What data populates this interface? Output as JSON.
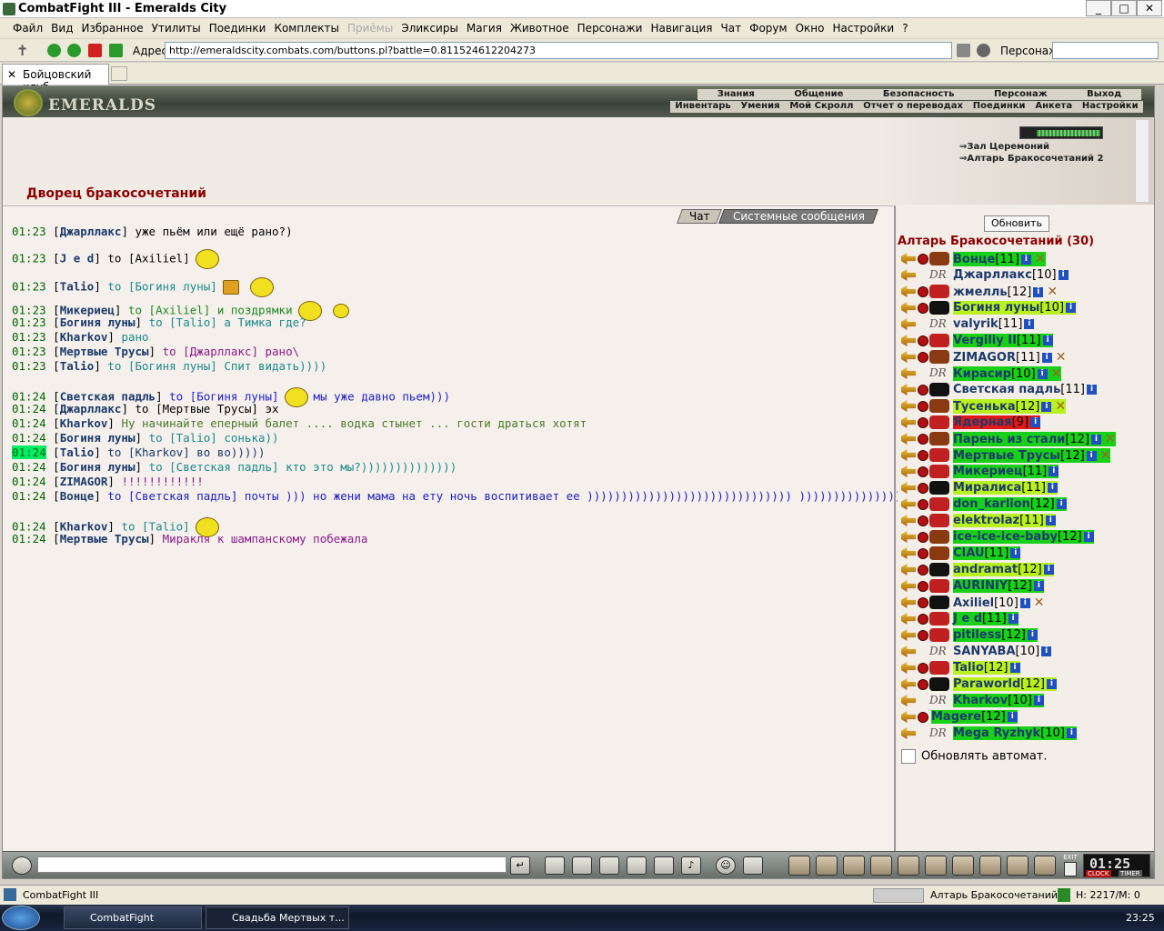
{
  "window": {
    "title": "CombatFight III - Emeralds City"
  },
  "menu": [
    "Файл",
    "Вид",
    "Избранное",
    "Утилиты",
    "Поединки",
    "Комплекты",
    "Приёмы",
    "Эликсиры",
    "Магия",
    "Животное",
    "Персонажи",
    "Навигация",
    "Чат",
    "Форум",
    "Окно",
    "Настройки",
    "?"
  ],
  "address": {
    "label": "Адрес:",
    "url": "http://emeraldscity.combats.com/buttons.pl?battle=0.811524612204273",
    "pers_label": "Персонаж:"
  },
  "tab": {
    "label": "Бойцовский клуб"
  },
  "logo": "EMERALDS",
  "nav1": [
    "Знания",
    "Общение",
    "Безопасность",
    "Персонаж",
    "Выход"
  ],
  "nav2": [
    "Инвентарь",
    "Умения",
    "Мой Скролл",
    "Отчет о переводах",
    "Поединки",
    "Анкета",
    "Настройки"
  ],
  "location": {
    "title": "Дворец бракосочетаний",
    "links": [
      "Зал Церемоний",
      "Алтарь Бракосочетаний 2"
    ]
  },
  "chat_tabs": {
    "chat": "Чат",
    "system": "Системные сообщения"
  },
  "messages": [
    {
      "time": "01:23",
      "nick": "Джарллакс",
      "text": "уже пьём или ещё рано?)",
      "color": "c-black"
    },
    {
      "time": "01:23",
      "nick": "J e d",
      "text": "to [Axiliel]",
      "color": "c-black"
    },
    {
      "time": "01:23",
      "nick": "Talio",
      "text": "to [Богиня луны]",
      "color": "c-teal"
    },
    {
      "time": "01:23",
      "nick": "Микериец",
      "text": "to [Axiliel] и поздрямки",
      "color": "c-green"
    },
    {
      "time": "01:23",
      "nick": "Богиня луны",
      "text": "to [Talio] а Тимка где?",
      "color": "c-teal"
    },
    {
      "time": "01:23",
      "nick": "Kharkov",
      "text": "рано",
      "color": "c-teal"
    },
    {
      "time": "01:23",
      "nick": "Мертвые Трусы",
      "text": "to [Джарллакс] рано\\",
      "color": "c-purple"
    },
    {
      "time": "01:23",
      "nick": "Talio",
      "text": "to [Богиня луны] Спит видать))))",
      "color": "c-teal"
    },
    {
      "time": "01:24",
      "nick": "Светская падль",
      "text": "to [Богиня луны]",
      "color": "c-blue"
    },
    {
      "time": "01:24",
      "nick": "Джарллакс",
      "text": "to [Мертвые Трусы] эх",
      "color": "c-black"
    },
    {
      "time": "01:24",
      "nick": "Kharkov",
      "text": "Ну начинайте еперный балет .... водка стынет ... гости драться хотят",
      "color": "c-olive"
    },
    {
      "time": "01:24",
      "nick": "Богиня луны",
      "text": "to [Talio] сонька))",
      "color": "c-teal"
    },
    {
      "time": "01:24",
      "nick": "Talio",
      "text": "to [Kharkov] во во)))))",
      "color": "c-navy"
    },
    {
      "time": "01:24",
      "nick": "Богиня луны",
      "text": "to [Светская падль] кто это мы?))))))))))))))",
      "color": "c-teal"
    },
    {
      "time": "01:24",
      "nick": "ZIMAGOR",
      "text": "!!!!!!!!!!!!",
      "color": "c-purple"
    },
    {
      "time": "01:24",
      "nick": "Вонце",
      "text": "to [Светская падль] почты ))) но жени мама на ету ночь воспитивает ее )))))))))))))))))))))))))))))) )))))))))))))))))))))))))",
      "color": "c-blue"
    },
    {
      "time": "01:24",
      "nick": "Kharkov",
      "text": "to [Talio]",
      "color": "c-teal"
    },
    {
      "time": "01:24",
      "nick": "Мертвые Трусы",
      "text": "Миракля к шампанскому побежала",
      "color": "c-purple"
    }
  ],
  "msg_extra": {
    "m9_tail": "мы уже давно пьем)))"
  },
  "right": {
    "refresh": "Обновить",
    "room": "Алтарь Бракосочетаний (30)",
    "auto": "Обновлять автомат."
  },
  "players": [
    {
      "name": "Вонце",
      "lvl": "[11]",
      "bg": "bg-g",
      "icon": "brn",
      "x": true
    },
    {
      "name": "Джарллакс",
      "lvl": "[10]",
      "bg": "",
      "icon": "dr",
      "x": false
    },
    {
      "name": "жмелль",
      "lvl": "[12]",
      "bg": "",
      "icon": "red",
      "x": true
    },
    {
      "name": "Богиня луны",
      "lvl": "[10]",
      "bg": "bg-y",
      "icon": "blk",
      "x": false
    },
    {
      "name": "valyrik",
      "lvl": "[11]",
      "bg": "",
      "icon": "dr",
      "x": false
    },
    {
      "name": "Vergiliy II",
      "lvl": "[11]",
      "bg": "bg-g",
      "icon": "red",
      "x": false
    },
    {
      "name": "ZIMAGOR",
      "lvl": "[11]",
      "bg": "",
      "icon": "brn",
      "x": true
    },
    {
      "name": "Кирасир",
      "lvl": "[10]",
      "bg": "bg-g",
      "icon": "dr",
      "x": true
    },
    {
      "name": "Светская падль",
      "lvl": "[11]",
      "bg": "",
      "icon": "blk",
      "x": false
    },
    {
      "name": "Тусенька",
      "lvl": "[12]",
      "bg": "bg-y",
      "icon": "brn",
      "x": true
    },
    {
      "name": "Ядерная",
      "lvl": "[9]",
      "bg": "bg-r",
      "icon": "red",
      "x": false
    },
    {
      "name": "Парень из стали",
      "lvl": "[12]",
      "bg": "bg-g",
      "icon": "brn",
      "x": true
    },
    {
      "name": "Мертвые Трусы",
      "lvl": "[12]",
      "bg": "bg-g",
      "icon": "red",
      "x": true
    },
    {
      "name": "Микериец",
      "lvl": "[11]",
      "bg": "bg-g",
      "icon": "red",
      "x": false
    },
    {
      "name": "Миралиса",
      "lvl": "[11]",
      "bg": "bg-y",
      "icon": "blk",
      "x": false
    },
    {
      "name": "don_karlion",
      "lvl": "[12]",
      "bg": "bg-g",
      "icon": "red",
      "x": false
    },
    {
      "name": "elektrolaz",
      "lvl": "[11]",
      "bg": "bg-y",
      "icon": "red",
      "x": false
    },
    {
      "name": "ice-ice-ice-baby",
      "lvl": "[12]",
      "bg": "bg-g",
      "icon": "brn",
      "x": false
    },
    {
      "name": "CIAU",
      "lvl": "[11]",
      "bg": "bg-g",
      "icon": "brn",
      "x": false
    },
    {
      "name": "andramat",
      "lvl": "[12]",
      "bg": "bg-y",
      "icon": "blk",
      "x": false
    },
    {
      "name": "AURINIY",
      "lvl": "[12]",
      "bg": "bg-g",
      "icon": "red",
      "x": false
    },
    {
      "name": "Axiliel",
      "lvl": "[10]",
      "bg": "",
      "icon": "blk",
      "x": true
    },
    {
      "name": "J e d",
      "lvl": "[11]",
      "bg": "bg-g",
      "icon": "red",
      "x": false
    },
    {
      "name": "pitiless",
      "lvl": "[12]",
      "bg": "bg-g",
      "icon": "red",
      "x": false
    },
    {
      "name": "SANYABA",
      "lvl": "[10]",
      "bg": "",
      "icon": "dr",
      "x": false
    },
    {
      "name": "Talio",
      "lvl": "[12]",
      "bg": "bg-y",
      "icon": "red",
      "x": false
    },
    {
      "name": "Paraworld",
      "lvl": "[12]",
      "bg": "bg-y",
      "icon": "blk",
      "x": false
    },
    {
      "name": "Kharkov",
      "lvl": "[10]",
      "bg": "bg-g",
      "icon": "dr",
      "x": false
    },
    {
      "name": "Magere",
      "lvl": "[12]",
      "bg": "bg-g",
      "icon": "",
      "x": false
    },
    {
      "name": "Mega Ryzhyk",
      "lvl": "[10]",
      "bg": "bg-g",
      "icon": "dr",
      "x": false
    }
  ],
  "clock": {
    "time": "01:25",
    "clock": "CLOCK",
    "timer": "TIMER",
    "exit": "EXIT"
  },
  "status": {
    "left": "CombatFight III",
    "room": "Алтарь Бракосочетаний",
    "hp": "H: 2217/M: 0"
  },
  "taskbar": {
    "t1": "CombatFight",
    "t2": "Свадьба Мертвых т...",
    "time": "23:25"
  }
}
